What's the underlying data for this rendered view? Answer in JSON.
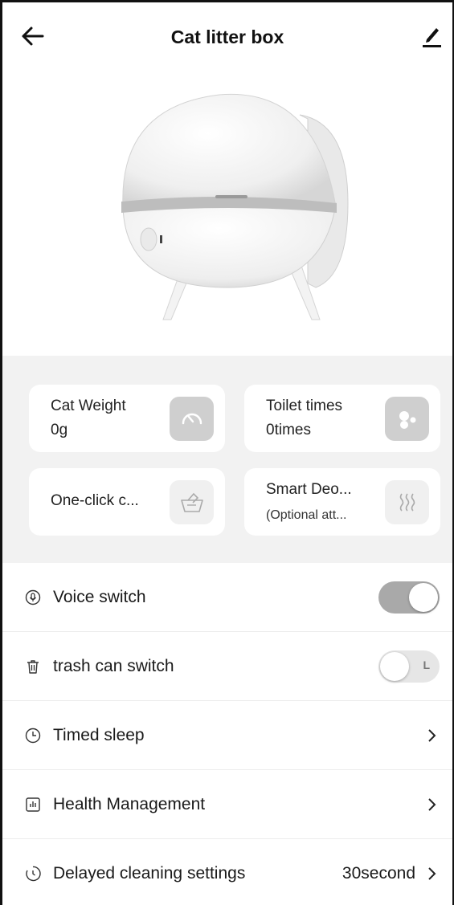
{
  "header": {
    "title": "Cat litter box"
  },
  "device": {
    "image": "cat-litter-box-device"
  },
  "cards": [
    {
      "label": "Cat Weight",
      "value": "0g",
      "icon": "scale-gauge-icon"
    },
    {
      "label": "Toilet times",
      "value": "0times",
      "icon": "cat-paw-icon"
    },
    {
      "label": "One-click c...",
      "icon": "cleaning-basin-icon"
    },
    {
      "label": "Smart Deo...",
      "sub": "(Optional att...",
      "icon": "deodorize-waves-icon"
    }
  ],
  "settings": [
    {
      "label": "Voice switch",
      "icon": "microphone-icon",
      "type": "toggle",
      "on": true
    },
    {
      "label": "trash can switch",
      "icon": "trash-can-icon",
      "type": "toggle",
      "on": false,
      "toggle_mark": "L"
    },
    {
      "label": "Timed sleep",
      "icon": "clock-icon",
      "type": "link"
    },
    {
      "label": "Health Management",
      "icon": "bar-chart-icon",
      "type": "link"
    },
    {
      "label": "Delayed cleaning settings",
      "icon": "timer-icon",
      "type": "link",
      "value": "30second"
    }
  ],
  "colors": {
    "background": "#ffffff",
    "cards_background": "#f2f2f2",
    "toggle_on": "#a9a9a9",
    "toggle_off": "#e6e6e6"
  }
}
